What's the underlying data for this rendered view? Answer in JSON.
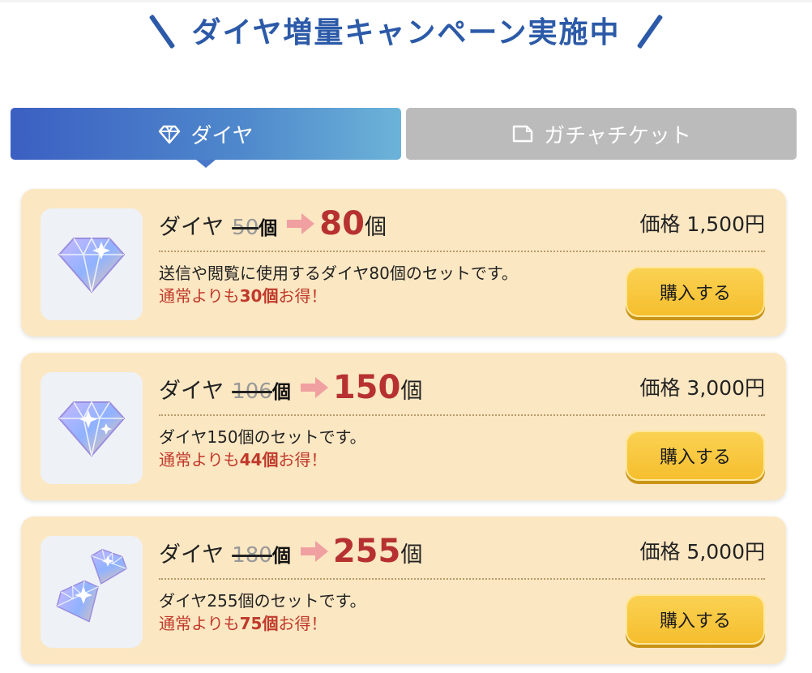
{
  "banner": {
    "title": "ダイヤ増量キャンペーン実施中"
  },
  "tabs": [
    {
      "label": "ダイヤ",
      "icon": "diamond-icon",
      "active": true
    },
    {
      "label": "ガチャチケット",
      "icon": "ticket-icon",
      "active": false
    }
  ],
  "colors": {
    "accent": "#2c5aa8",
    "card_bg": "#fbe7c2",
    "deal_red": "#c0392b",
    "button_yellow": "#f5be2d"
  },
  "products": [
    {
      "product": "ダイヤ",
      "old_count": "50",
      "old_unit": "個",
      "new_count": "80",
      "new_unit": "個",
      "price": "価格 1,500円",
      "description": "送信や閲覧に使用するダイヤ80個のセットです。",
      "deal_prefix": "通常よりも",
      "deal_amount": "30個",
      "deal_suffix": "お得！",
      "buy_label": "購入する"
    },
    {
      "product": "ダイヤ",
      "old_count": "106",
      "old_unit": "個",
      "new_count": "150",
      "new_unit": "個",
      "price": "価格 3,000円",
      "description": "ダイヤ150個のセットです。",
      "deal_prefix": "通常よりも",
      "deal_amount": "44個",
      "deal_suffix": "お得！",
      "buy_label": "購入する"
    },
    {
      "product": "ダイヤ",
      "old_count": "180",
      "old_unit": "個",
      "new_count": "255",
      "new_unit": "個",
      "price": "価格 5,000円",
      "description": "ダイヤ255個のセットです。",
      "deal_prefix": "通常よりも",
      "deal_amount": "75個",
      "deal_suffix": "お得！",
      "buy_label": "購入する"
    }
  ]
}
